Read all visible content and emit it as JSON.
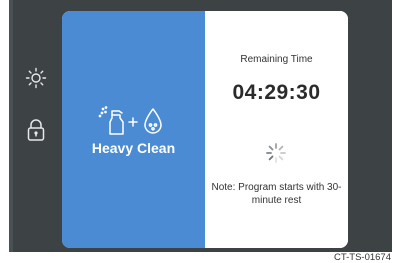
{
  "controls": {
    "brightness_icon": "sun-icon",
    "lock_icon": "lock-icon"
  },
  "program": {
    "name": "Heavy Clean",
    "icon": "spray-plus-drop-icon"
  },
  "status": {
    "remaining_label": "Remaining Time",
    "time": "04:29:30",
    "note": "Note: Program starts with 30-minute rest"
  },
  "caption": "CT-TS-01674",
  "colors": {
    "program_panel": "#4a8bd4",
    "device_frame": "#3d4245"
  }
}
